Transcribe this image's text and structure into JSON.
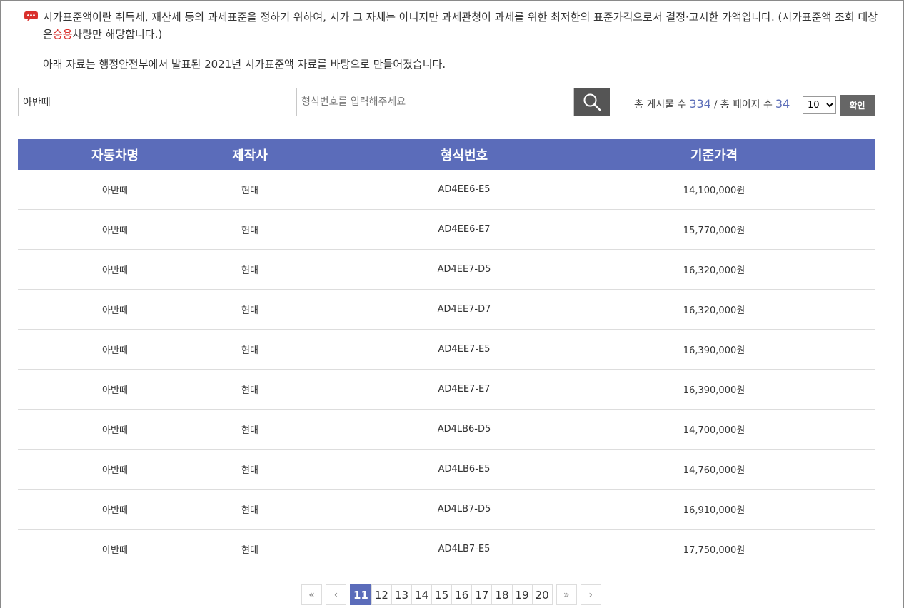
{
  "notice": {
    "line1_a": "시가표준액이란 취득세, 재산세 등의 과세표준을 정하기 위하여, 시가 그 자체는 아니지만 과세관청이 과세를 위한 최저한의 표준가격으로서 결정·고시한 가액입니다. (시가표준액 조회 대상은",
    "line1_red": "승용",
    "line1_b": "차량만 해당합니다.)",
    "line2": "아래 자료는 행정안전부에서 발표된 2021년 시가표준액 자료를 바탕으로 만들어졌습니다."
  },
  "search": {
    "keyword_value": "아반떼",
    "code_placeholder": "형식번호를 입력해주세요",
    "search_icon": "magnifier-icon"
  },
  "stats": {
    "total_posts_label": "총 게시물 수",
    "total_posts": "334",
    "separator": "/",
    "total_pages_label": "총 페이지 수",
    "total_pages": "34",
    "per_page": "10",
    "confirm_label": "확인"
  },
  "table": {
    "headers": [
      "자동차명",
      "제작사",
      "형식번호",
      "기준가격"
    ],
    "rows": [
      [
        "아반떼",
        "현대",
        "AD4EE6-E5",
        "14,100,000원"
      ],
      [
        "아반떼",
        "현대",
        "AD4EE6-E7",
        "15,770,000원"
      ],
      [
        "아반떼",
        "현대",
        "AD4EE7-D5",
        "16,320,000원"
      ],
      [
        "아반떼",
        "현대",
        "AD4EE7-D7",
        "16,320,000원"
      ],
      [
        "아반떼",
        "현대",
        "AD4EE7-E5",
        "16,390,000원"
      ],
      [
        "아반떼",
        "현대",
        "AD4EE7-E7",
        "16,390,000원"
      ],
      [
        "아반떼",
        "현대",
        "AD4LB6-D5",
        "14,700,000원"
      ],
      [
        "아반떼",
        "현대",
        "AD4LB6-E5",
        "14,760,000원"
      ],
      [
        "아반떼",
        "현대",
        "AD4LB7-D5",
        "16,910,000원"
      ],
      [
        "아반떼",
        "현대",
        "AD4LB7-E5",
        "17,750,000원"
      ]
    ]
  },
  "pagination": {
    "first": "«",
    "prev": "‹",
    "pages": [
      "11",
      "12",
      "13",
      "14",
      "15",
      "16",
      "17",
      "18",
      "19",
      "20"
    ],
    "current": "11",
    "next_block": "»",
    "next": "›"
  },
  "colors": {
    "accent": "#5b6cba",
    "highlight_red": "#d9302c",
    "button_dark": "#555555"
  }
}
